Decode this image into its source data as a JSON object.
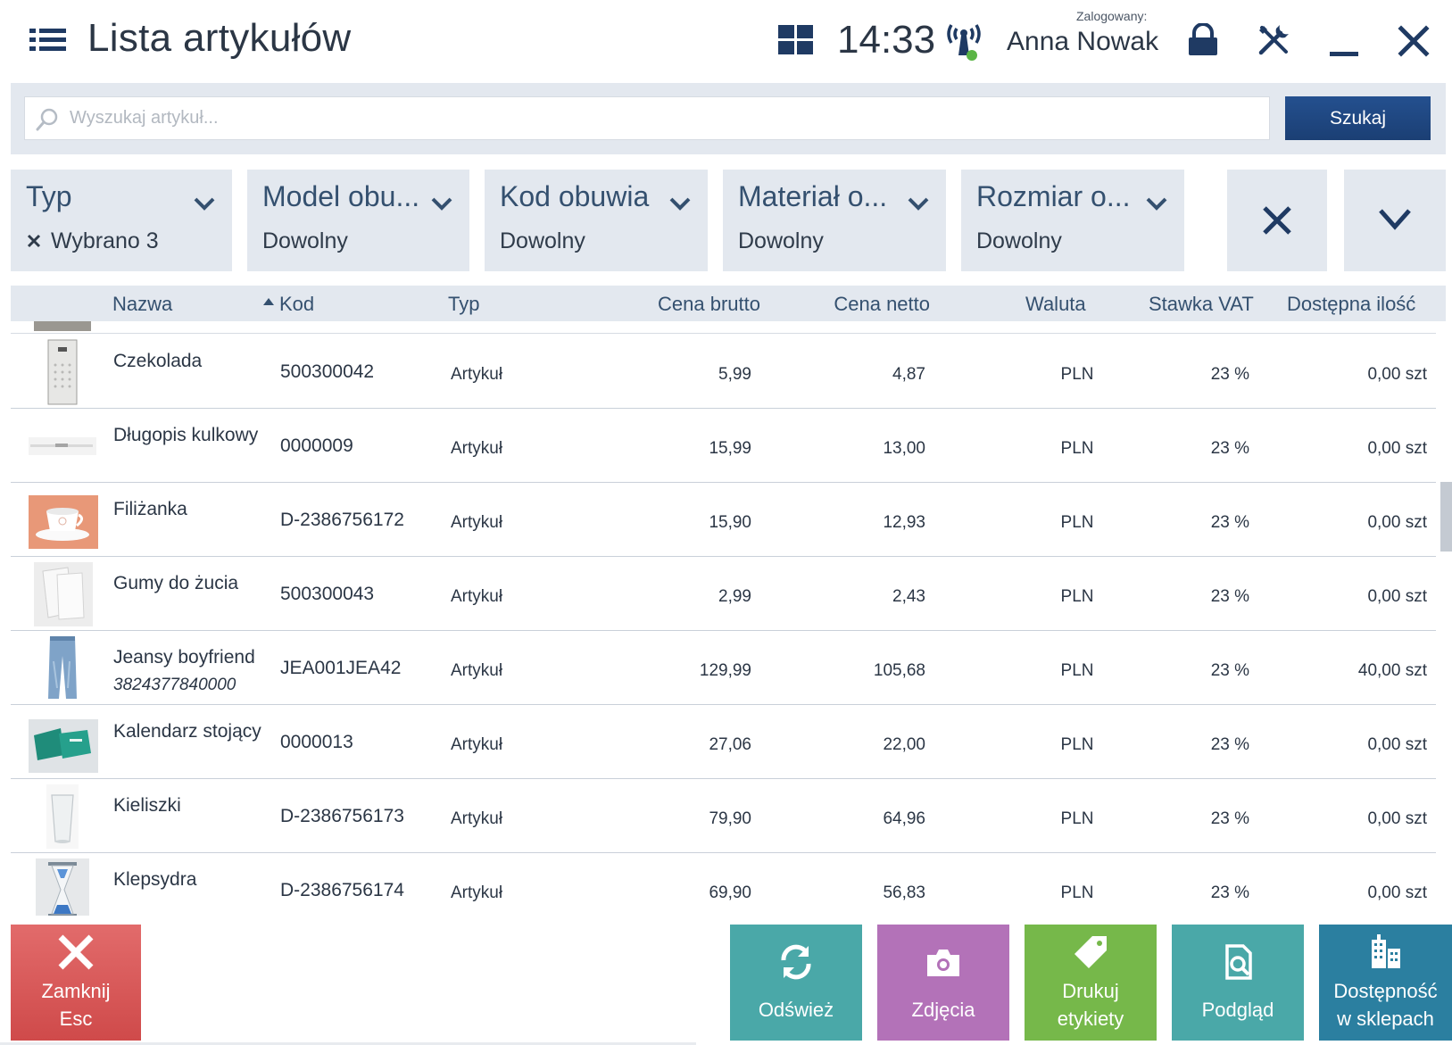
{
  "header": {
    "title": "Lista artykułów",
    "clock": "14:33",
    "logged_label": "Zalogowany:",
    "user_name": "Anna Nowak"
  },
  "search": {
    "placeholder": "Wyszukaj artykuł...",
    "value": "",
    "button_label": "Szukaj"
  },
  "filters": [
    {
      "label": "Typ",
      "value": "Wybrano 3",
      "has_clear": true
    },
    {
      "label": "Model obu...",
      "value": "Dowolny"
    },
    {
      "label": "Kod obuwia",
      "value": "Dowolny"
    },
    {
      "label": "Materiał o...",
      "value": "Dowolny"
    },
    {
      "label": "Rozmiar o...",
      "value": "Dowolny"
    }
  ],
  "table": {
    "columns": [
      "Nazwa",
      "Kod",
      "Typ",
      "Cena brutto",
      "Cena netto",
      "Waluta",
      "Stawka VAT",
      "Dostępna ilość"
    ],
    "sorted_column": "Nazwa",
    "rows": [
      {
        "name": "Czekolada",
        "sub": "",
        "code": "500300042",
        "type": "Artykuł",
        "brutto": "5,99",
        "netto": "4,87",
        "currency": "PLN",
        "vat": "23 %",
        "qty": "0,00 szt",
        "thumb": "chocolate"
      },
      {
        "name": "Długopis kulkowy",
        "sub": "",
        "code": "0000009",
        "type": "Artykuł",
        "brutto": "15,99",
        "netto": "13,00",
        "currency": "PLN",
        "vat": "23 %",
        "qty": "0,00 szt",
        "thumb": "pen"
      },
      {
        "name": "Filiżanka",
        "sub": "",
        "code": "D-2386756172",
        "type": "Artykuł",
        "brutto": "15,90",
        "netto": "12,93",
        "currency": "PLN",
        "vat": "23 %",
        "qty": "0,00 szt",
        "thumb": "cup"
      },
      {
        "name": "Gumy do żucia",
        "sub": "",
        "code": "500300043",
        "type": "Artykuł",
        "brutto": "2,99",
        "netto": "2,43",
        "currency": "PLN",
        "vat": "23 %",
        "qty": "0,00 szt",
        "thumb": "gum"
      },
      {
        "name": "Jeansy boyfriend",
        "sub": "3824377840000",
        "code": "JEA001JEA42",
        "type": "Artykuł",
        "brutto": "129,99",
        "netto": "105,68",
        "currency": "PLN",
        "vat": "23 %",
        "qty": "40,00 szt",
        "thumb": "jeans"
      },
      {
        "name": "Kalendarz stojący",
        "sub": "",
        "code": "0000013",
        "type": "Artykuł",
        "brutto": "27,06",
        "netto": "22,00",
        "currency": "PLN",
        "vat": "23 %",
        "qty": "0,00 szt",
        "thumb": "calendar"
      },
      {
        "name": "Kieliszki",
        "sub": "",
        "code": "D-2386756173",
        "type": "Artykuł",
        "brutto": "79,90",
        "netto": "64,96",
        "currency": "PLN",
        "vat": "23 %",
        "qty": "0,00 szt",
        "thumb": "glass"
      },
      {
        "name": "Klepsydra",
        "sub": "",
        "code": "D-2386756174",
        "type": "Artykuł",
        "brutto": "69,90",
        "netto": "56,83",
        "currency": "PLN",
        "vat": "23 %",
        "qty": "0,00 szt",
        "thumb": "hourglass"
      }
    ]
  },
  "actions": {
    "close": {
      "line1": "Zamknij",
      "line2": "Esc",
      "icon": "close-icon",
      "color": "#d9595a"
    },
    "refresh": {
      "label": "Odśwież",
      "icon": "refresh-icon",
      "color": "#4aa8a8"
    },
    "photos": {
      "label": "Zdjęcia",
      "icon": "camera-icon",
      "color": "#b372b8"
    },
    "print": {
      "line1": "Drukuj",
      "line2": "etykiety",
      "icon": "tag-icon",
      "color": "#76b84a"
    },
    "preview": {
      "label": "Podgląd",
      "icon": "preview-icon",
      "color": "#4aa8a8"
    },
    "availability": {
      "line1": "Dostępność",
      "line2": "w sklepach",
      "icon": "buildings-icon",
      "color": "#2b7fa0"
    }
  },
  "colors": {
    "accent_dark_blue": "#1b3f74",
    "panel_bg": "#e3e8ef",
    "header_text": "#34506f"
  }
}
